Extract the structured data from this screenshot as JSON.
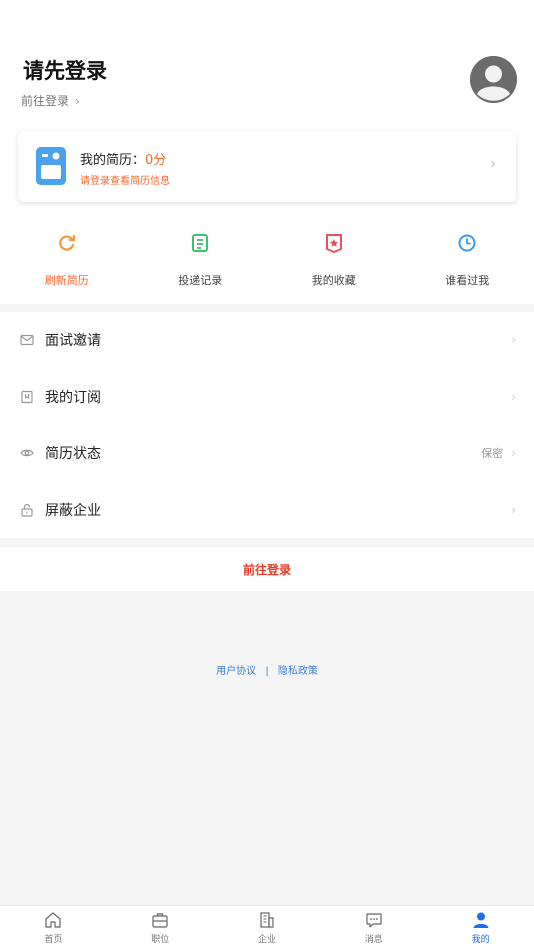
{
  "profile": {
    "title": "请先登录",
    "login_link": "前往登录",
    "chevron": "›",
    "avatar_icon": "user-avatar-icon"
  },
  "resume": {
    "label": "我的简历：",
    "score": "0分",
    "subtitle": "请登录查看简历信息",
    "chevron": "›"
  },
  "quick_actions": [
    {
      "label": "刷新简历",
      "icon": "refresh-icon",
      "color": "#f29a3b"
    },
    {
      "label": "投递记录",
      "icon": "document-icon",
      "color": "#37c26b"
    },
    {
      "label": "我的收藏",
      "icon": "favorite-icon",
      "color": "#e8505b"
    },
    {
      "label": "谁看过我",
      "icon": "clock-icon",
      "color": "#3a9af0"
    }
  ],
  "menu": [
    {
      "label": "面试邀请",
      "icon": "mail-icon",
      "right": ""
    },
    {
      "label": "我的订阅",
      "icon": "bookmark-icon",
      "right": ""
    },
    {
      "label": "简历状态",
      "icon": "eye-icon",
      "right": "保密"
    },
    {
      "label": "屏蔽企业",
      "icon": "lock-icon",
      "right": ""
    }
  ],
  "menu_chevron": "›",
  "login_button": "前往登录",
  "policy": {
    "user_agreement": "用户协议",
    "separator": "|",
    "privacy_policy": "隐私政策"
  },
  "tabs": [
    {
      "label": "首页",
      "icon": "home-icon"
    },
    {
      "label": "职位",
      "icon": "briefcase-icon"
    },
    {
      "label": "企业",
      "icon": "building-icon"
    },
    {
      "label": "消息",
      "icon": "message-icon"
    },
    {
      "label": "我的",
      "icon": "person-icon",
      "active": true
    }
  ],
  "colors": {
    "accent_orange": "#f26a2e",
    "login_red": "#e53b2c",
    "link_blue": "#3b7ddd",
    "tab_active_blue": "#1f6fe5"
  }
}
